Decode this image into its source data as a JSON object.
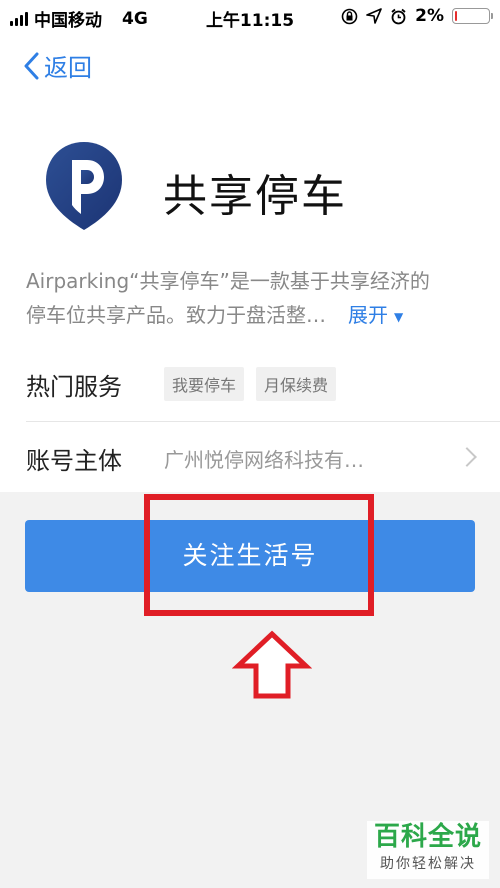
{
  "status_bar": {
    "carrier": "中国移动",
    "network": "4G",
    "time": "上午11:15",
    "battery_percent": "2%",
    "battery_level": 0.02,
    "battery_color": "#e62e2e"
  },
  "nav": {
    "back_label": "返回"
  },
  "app": {
    "name": "共享停车",
    "desc_line1": "Airparking“共享停车”是一款基于共享经济的",
    "desc_line2": "停车位共享产品。致力于盘活整…",
    "expand_label": "展开"
  },
  "hot_services": {
    "label": "热门服务",
    "tags": [
      "我要停车",
      "月保续费"
    ]
  },
  "account": {
    "label": "账号主体",
    "value": "广州悦停网络科技有…"
  },
  "follow_button": {
    "label": "关注生活号"
  },
  "watermark": {
    "main": "百科全说",
    "sub": "助你轻松解决"
  },
  "colors": {
    "accent": "#3e8ae6",
    "link": "#2f7fe5",
    "annotation": "#e01e26",
    "watermark": "#2ca84a"
  }
}
